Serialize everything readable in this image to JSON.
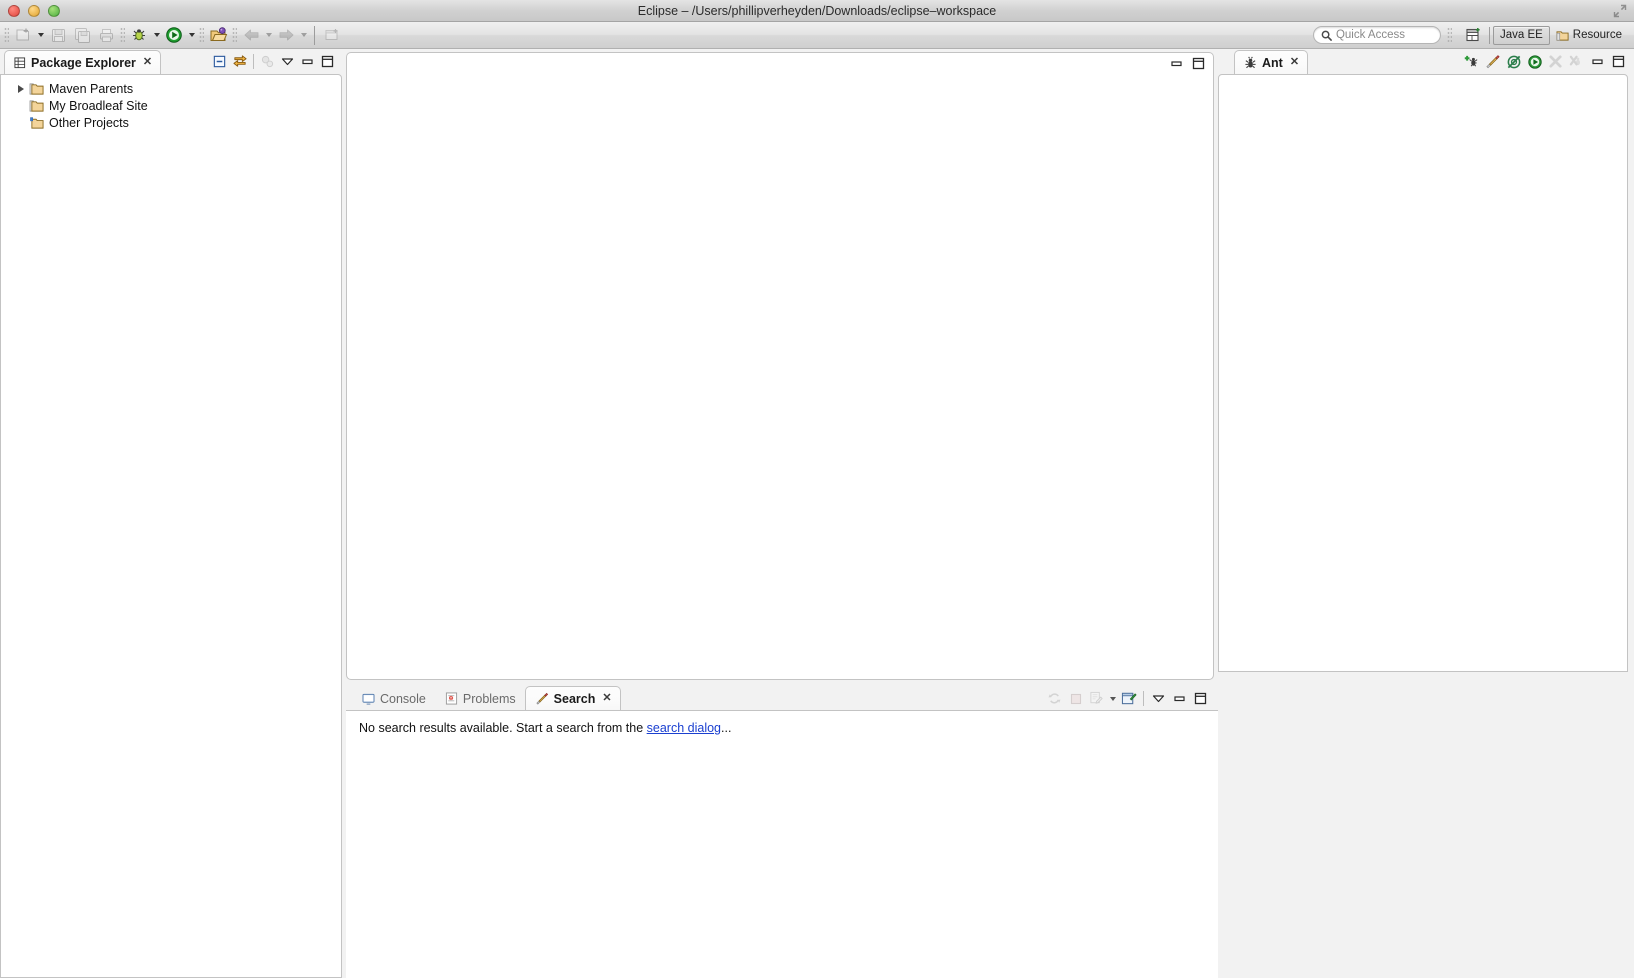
{
  "window": {
    "title": "Eclipse – /Users/phillipverheyden/Downloads/eclipse–workspace",
    "traffic_lights": [
      "close",
      "minimize",
      "zoom"
    ],
    "expand_icon": "fullscreen-icon"
  },
  "toolbar": {
    "items": [
      {
        "name": "new-button",
        "label": "New",
        "dropdown": true,
        "enabled": true
      },
      {
        "name": "save-button",
        "label": "Save",
        "dropdown": false,
        "enabled": false
      },
      {
        "name": "save-all-button",
        "label": "Save All",
        "dropdown": false,
        "enabled": false
      },
      {
        "name": "print-button",
        "label": "Print",
        "dropdown": false,
        "enabled": false
      },
      {
        "name": "debug-button",
        "label": "Debug",
        "dropdown": true,
        "enabled": true
      },
      {
        "name": "run-button",
        "label": "Run",
        "dropdown": true,
        "enabled": true
      },
      {
        "name": "open-type-button",
        "label": "Open Type",
        "dropdown": false,
        "enabled": true
      },
      {
        "name": "back-button",
        "label": "Back",
        "dropdown": true,
        "enabled": false
      },
      {
        "name": "forward-button",
        "label": "Forward",
        "dropdown": true,
        "enabled": false
      },
      {
        "name": "new-editor-button",
        "label": "New Editor",
        "dropdown": false,
        "enabled": false
      }
    ],
    "quick_access": {
      "placeholder": "Quick Access",
      "value": "",
      "icon": "search-icon"
    },
    "perspective": {
      "open_icon": "open-perspective-icon",
      "buttons": [
        {
          "label": "Java EE",
          "active": true,
          "icon": null
        },
        {
          "label": "Resource",
          "active": false,
          "icon": "folder-icon"
        }
      ]
    }
  },
  "package_explorer": {
    "tab_label": "Package Explorer",
    "tab_icon": "package-explorer-icon",
    "close_glyph": "✕",
    "tools": [
      {
        "name": "collapse-all-icon",
        "enabled": true
      },
      {
        "name": "link-with-editor-icon",
        "enabled": true
      },
      {
        "name": "focus-on-active-task-icon",
        "enabled": false
      },
      {
        "name": "view-menu-icon",
        "enabled": true
      },
      {
        "name": "minimize-icon",
        "enabled": true
      },
      {
        "name": "maximize-icon",
        "enabled": true
      }
    ],
    "tree": [
      {
        "label": "Maven Parents",
        "icon": "project-folder-icon",
        "expandable": true,
        "expanded": false,
        "indent": 0
      },
      {
        "label": "My Broadleaf Site",
        "icon": "project-folder-icon",
        "expandable": false,
        "expanded": false,
        "indent": 0
      },
      {
        "label": "Other Projects",
        "icon": "java-working-set-icon",
        "expandable": false,
        "expanded": false,
        "indent": 0
      }
    ]
  },
  "editor_area": {
    "empty": true,
    "minimize_icon": "minimize-icon",
    "maximize_icon": "maximize-icon"
  },
  "ant_view": {
    "tab_label": "Ant",
    "tab_icon": "ant-icon",
    "close_glyph": "✕",
    "tools": [
      {
        "name": "add-buildfiles-icon",
        "enabled": true
      },
      {
        "name": "run-ant-icon",
        "enabled": true
      },
      {
        "name": "hide-internal-targets-icon",
        "enabled": true
      },
      {
        "name": "run-default-target-icon",
        "enabled": true
      },
      {
        "name": "remove-buildfile-icon",
        "enabled": false
      },
      {
        "name": "remove-all-buildfiles-icon",
        "enabled": false
      },
      {
        "name": "minimize-icon",
        "enabled": true
      },
      {
        "name": "maximize-icon",
        "enabled": true
      }
    ],
    "content": ""
  },
  "bottom_panel": {
    "tabs": [
      {
        "label": "Console",
        "icon": "console-icon",
        "active": false
      },
      {
        "label": "Problems",
        "icon": "problems-icon",
        "active": false
      },
      {
        "label": "Search",
        "icon": "search-view-icon",
        "active": true
      }
    ],
    "close_glyph": "✕",
    "tools": [
      {
        "name": "rerun-search-icon",
        "enabled": false
      },
      {
        "name": "cancel-search-icon",
        "enabled": false
      },
      {
        "name": "search-history-icon",
        "enabled": false,
        "dropdown": true
      },
      {
        "name": "pin-search-view-icon",
        "enabled": true
      },
      {
        "name": "view-menu-icon",
        "enabled": true
      },
      {
        "name": "minimize-icon",
        "enabled": true
      },
      {
        "name": "maximize-icon",
        "enabled": true
      }
    ],
    "search_result": {
      "message_before": "No search results available. Start a search from the ",
      "link_text": "search dialog",
      "message_after": "..."
    }
  },
  "colors": {
    "accent_link": "#1a3fd0",
    "tab_active_bg": "#fbfbfb",
    "panel_bg": "#f2f2f2",
    "border": "#c3c3c3",
    "run_green": "#1f9d2f",
    "folder_tan": "#e8c270"
  }
}
